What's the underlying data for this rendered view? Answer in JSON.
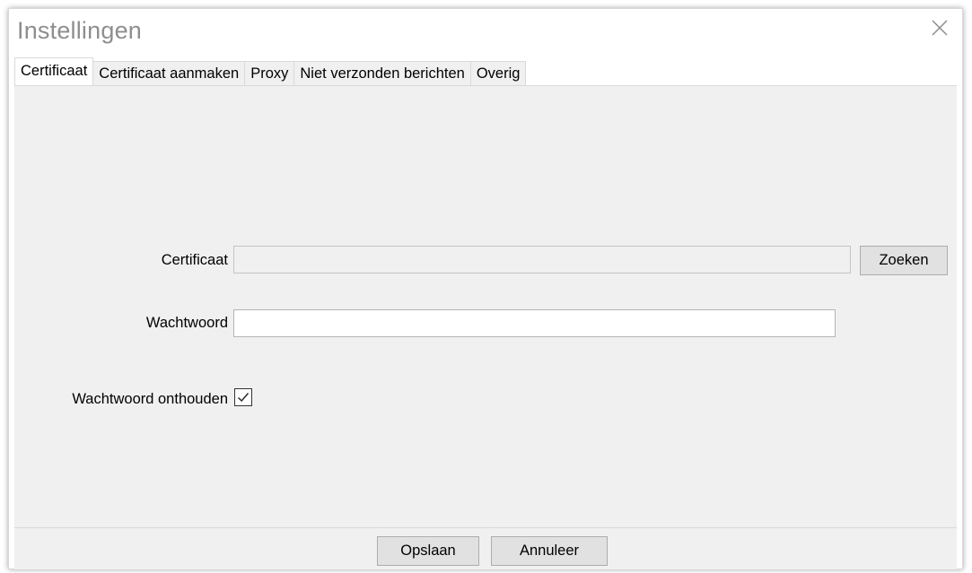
{
  "window": {
    "title": "Instellingen"
  },
  "tabs": [
    {
      "label": "Certificaat",
      "active": true
    },
    {
      "label": "Certificaat aanmaken",
      "active": false
    },
    {
      "label": "Proxy",
      "active": false
    },
    {
      "label": "Niet verzonden berichten",
      "active": false
    },
    {
      "label": "Overig",
      "active": false
    }
  ],
  "form": {
    "certificate_label": "Certificaat",
    "certificate_value": "",
    "search_button": "Zoeken",
    "password_label": "Wachtwoord",
    "password_value": "",
    "remember_label": "Wachtwoord onthouden",
    "remember_checked": true
  },
  "footer": {
    "save_button": "Opslaan",
    "cancel_button": "Annuleer"
  },
  "icons": {
    "close": "close-icon",
    "checkmark": "checkmark-icon"
  },
  "colors": {
    "panel_bg": "#f0f0f0",
    "title_text": "#8e8e8e",
    "button_bg": "#e1e1e1"
  }
}
